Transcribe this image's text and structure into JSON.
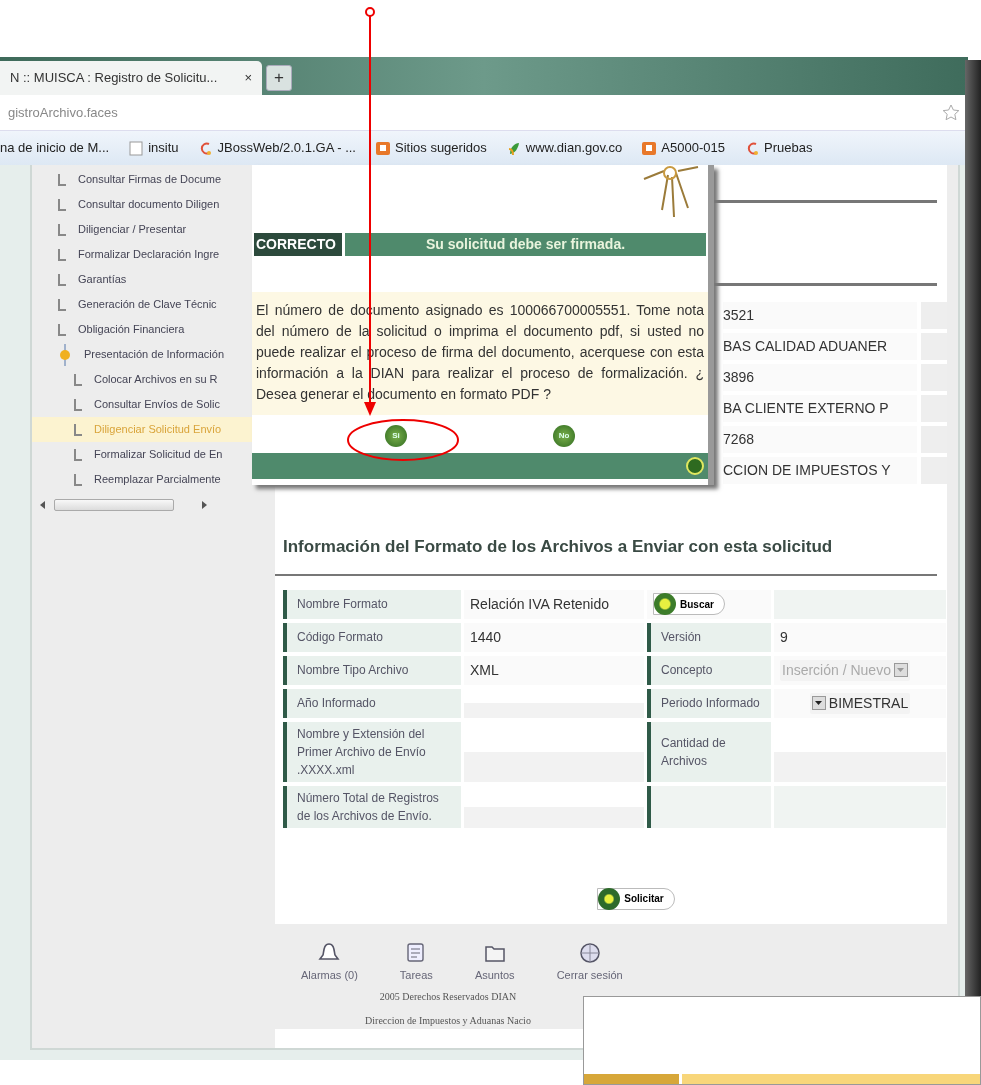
{
  "browser": {
    "tab": {
      "title": "N :: MUISCA : Registro de Solicitu...",
      "close": "×"
    },
    "new_tab": "+",
    "address": "gistroArchivo.faces",
    "bookmarks": [
      {
        "label": "na de inicio de M...",
        "kind": "none"
      },
      {
        "label": "insitu",
        "kind": "page"
      },
      {
        "label": "JBossWeb/2.0.1.GA - ...",
        "kind": "swirl"
      },
      {
        "label": "Sitios sugeridos",
        "kind": "orange"
      },
      {
        "label": "www.dian.gov.co",
        "kind": "leaf"
      },
      {
        "label": "A5000-015",
        "kind": "orange"
      },
      {
        "label": "Pruebas",
        "kind": "swirl"
      }
    ]
  },
  "sidebar": {
    "items": [
      {
        "label": "Consultar Firmas de Docume",
        "selected": false
      },
      {
        "label": "Consultar documento Diligen",
        "selected": false
      },
      {
        "label": "Diligenciar / Presentar",
        "selected": false
      },
      {
        "label": "Formalizar Declaración Ingre",
        "selected": false
      },
      {
        "label": "Garantías",
        "selected": false
      },
      {
        "label": "Generación de Clave Técnic",
        "selected": false
      },
      {
        "label": "Obligación Financiera",
        "selected": false
      },
      {
        "label": "Presentación de Información",
        "selected": false,
        "expanded": true,
        "children": [
          {
            "label": "Colocar Archivos en su R",
            "selected": false
          },
          {
            "label": "Consultar Envíos de Solic",
            "selected": false
          },
          {
            "label": "Diligenciar Solicitud Envío",
            "selected": true
          },
          {
            "label": "Formalizar Solicitud de En",
            "selected": false
          },
          {
            "label": "Reemplazar Parcialmente",
            "selected": false
          }
        ]
      }
    ]
  },
  "background_values": [
    "3521",
    "BAS CALIDAD ADUANER",
    "3896",
    "BA CLIENTE EXTERNO P",
    "7268",
    "CCION DE IMPUESTOS Y"
  ],
  "section_title": "Información del Formato de los Archivos a Enviar con esta solicitud",
  "form": {
    "rows": [
      [
        {
          "kind": "label",
          "text": "Nombre Formato"
        },
        {
          "kind": "value",
          "text": "Relación IVA Retenido"
        },
        {
          "kind": "button",
          "text": "Buscar"
        },
        {
          "kind": "empty"
        }
      ],
      [
        {
          "kind": "label",
          "text": "Código Formato"
        },
        {
          "kind": "value",
          "text": "1440"
        },
        {
          "kind": "label",
          "text": "Versión"
        },
        {
          "kind": "value",
          "text": "9"
        }
      ],
      [
        {
          "kind": "label",
          "text": "Nombre Tipo Archivo"
        },
        {
          "kind": "value",
          "text": "XML"
        },
        {
          "kind": "label",
          "text": "Concepto"
        },
        {
          "kind": "select",
          "value": "Inserción / Nuevo",
          "disabled": true
        }
      ],
      [
        {
          "kind": "label",
          "text": "Año Informado"
        },
        {
          "kind": "input"
        },
        {
          "kind": "label",
          "text": "Periodo Informado"
        },
        {
          "kind": "select",
          "value": "BIMESTRAL",
          "disabled": false
        }
      ],
      [
        {
          "kind": "label",
          "text": "Nombre y Extensión del Primer Archivo de Envío .XXXX.xml"
        },
        {
          "kind": "input"
        },
        {
          "kind": "label",
          "text": "Cantidad de Archivos"
        },
        {
          "kind": "input"
        }
      ],
      [
        {
          "kind": "label",
          "text": "Número Total de Registros de los Archivos de Envío."
        },
        {
          "kind": "input"
        },
        {
          "kind": "empty"
        },
        {
          "kind": "empty"
        }
      ]
    ]
  },
  "submit": "Solicitar",
  "footer": {
    "links": [
      {
        "label": "Alarmas (0)",
        "kind": "bell"
      },
      {
        "label": "Tareas",
        "kind": "tasks"
      },
      {
        "label": "Asuntos",
        "kind": "folder"
      },
      {
        "label": "Cerrar sesión",
        "kind": "globe"
      }
    ],
    "copyright": [
      "2005 Derechos Reservados DIAN",
      "Direccion de Impuestos y Aduanas Nacio"
    ]
  },
  "modal": {
    "status": "CORRECTO",
    "title": "Su solicitud debe ser firmada.",
    "message": "El número de documento asignado es 100066700005551. Tome nota del número de la solicitud o imprima el documento pdf, si usted no puede realizar el proceso de firma del documento, acerquese con esta información a la DIAN para realizar el proceso de formalización. ¿ Desea generar el documento en formato PDF ?",
    "buttons": [
      "Si",
      "No"
    ]
  }
}
